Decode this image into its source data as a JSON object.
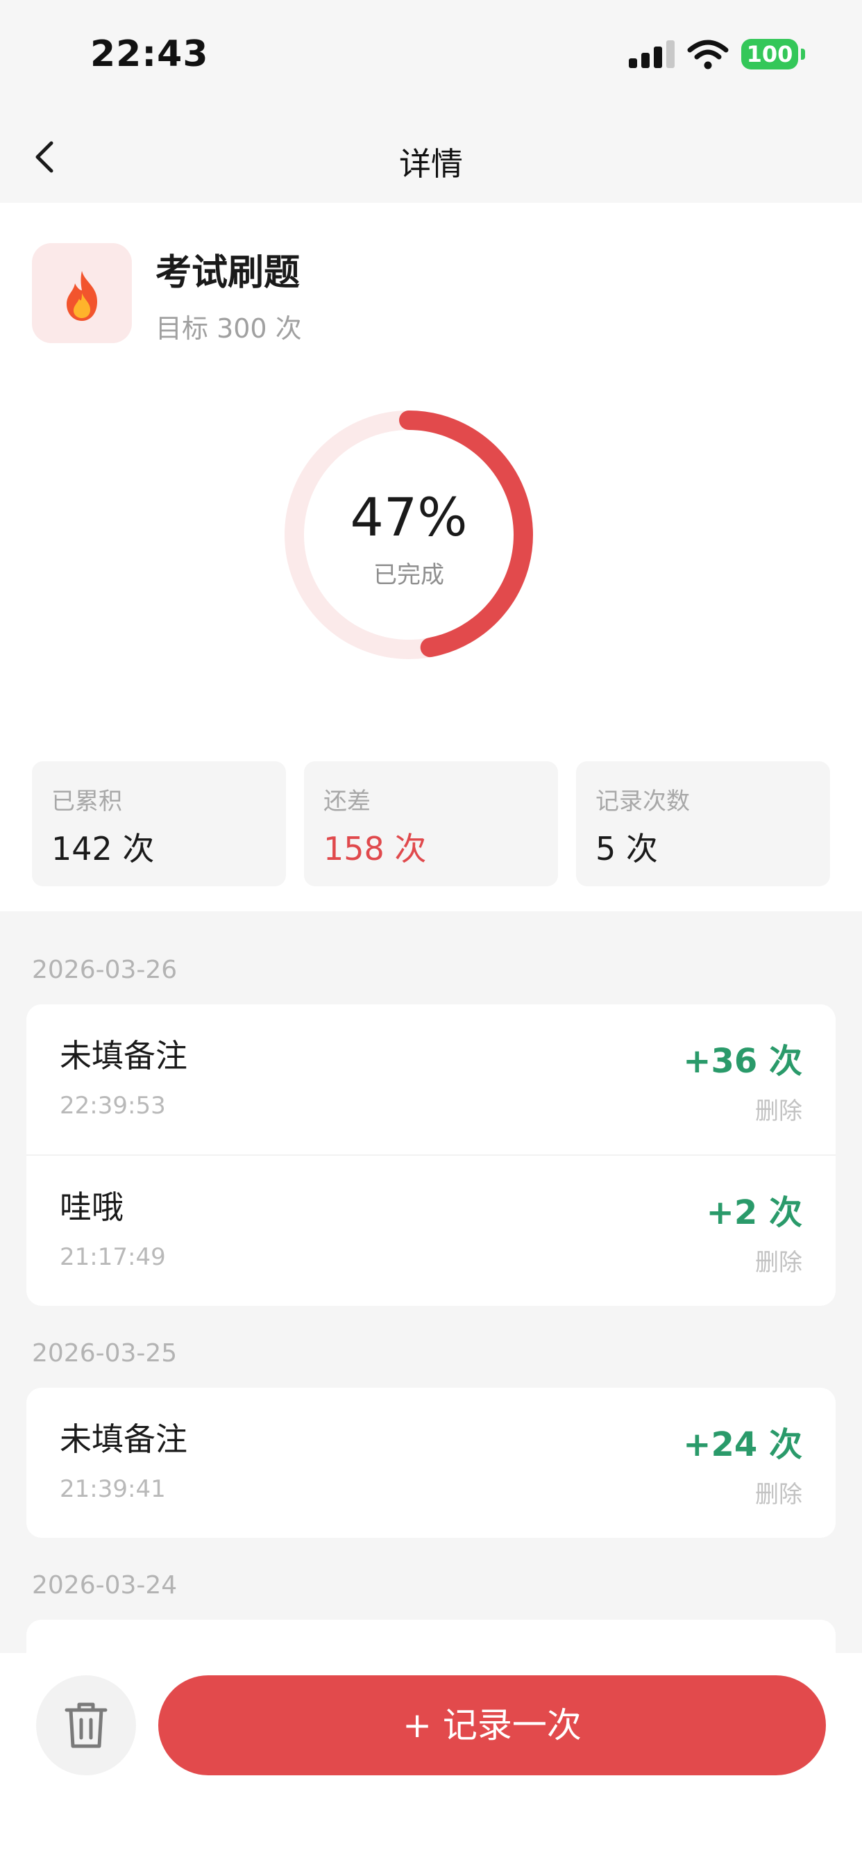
{
  "status_bar": {
    "time": "22:43",
    "battery": "100",
    "battery_color": "#34c759"
  },
  "nav": {
    "title": "详情",
    "back_icon": "chevron-left-icon"
  },
  "habit": {
    "icon": "fire-emoji",
    "icon_glyph": "🔥",
    "title": "考试刷题",
    "target": "目标 300 次"
  },
  "progress": {
    "percent_text": "47%",
    "fraction": 0.47,
    "label": "已完成",
    "accent_color": "#e24a4c",
    "track_color": "#fbeaea"
  },
  "stats": [
    {
      "label": "已累积",
      "value": "142 次"
    },
    {
      "label": "还差",
      "value": "158 次"
    },
    {
      "label": "记录次数",
      "value": "5 次"
    }
  ],
  "groups": [
    {
      "date": "2026-03-26",
      "records": [
        {
          "note": "未填备注",
          "time": "22:39:53",
          "amount": "+36 次",
          "delete": "删除"
        },
        {
          "note": "哇哦",
          "time": "21:17:49",
          "amount": "+2 次",
          "delete": "删除"
        }
      ]
    },
    {
      "date": "2026-03-25",
      "records": [
        {
          "note": "未填备注",
          "time": "21:39:41",
          "amount": "+24 次",
          "delete": "删除"
        }
      ]
    },
    {
      "date": "2026-03-24",
      "records": []
    }
  ],
  "bottom": {
    "trash_icon": "trash-icon",
    "record_button": "+ 记录一次"
  }
}
